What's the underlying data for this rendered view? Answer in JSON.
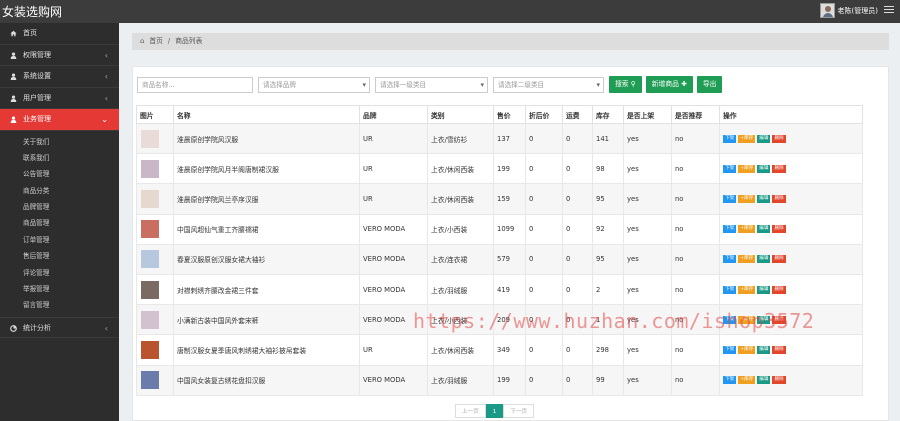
{
  "app": {
    "title": "女装选购网",
    "user": "老陈(管理员)"
  },
  "sidebar": {
    "items": [
      {
        "label": "首页",
        "icon": "home-icon"
      },
      {
        "label": "权限管理",
        "icon": "user-icon"
      },
      {
        "label": "系统设置",
        "icon": "user-icon"
      },
      {
        "label": "用户管理",
        "icon": "user-icon"
      },
      {
        "label": "业务管理",
        "icon": "user-icon"
      }
    ],
    "subitems": [
      "关于我们",
      "联系我们",
      "公告管理",
      "商品分类",
      "品牌管理",
      "商品管理",
      "订单管理",
      "售后管理",
      "评论管理",
      "举报管理",
      "留言管理"
    ],
    "bottom": {
      "label": "统计分析",
      "icon": "chart-icon"
    }
  },
  "breadcrumb": {
    "home": "首页",
    "sep": "/",
    "current": "商品列表"
  },
  "filters": {
    "name_placeholder": "商品名称...",
    "brand": "请选择品牌",
    "cat1": "请选择一级类目",
    "cat2": "请选择二级类目",
    "search": "搜索",
    "add": "新增商品",
    "export": "导出"
  },
  "table": {
    "headers": [
      "图片",
      "名称",
      "品牌",
      "类别",
      "售价",
      "折后价",
      "运费",
      "库存",
      "是否上架",
      "是否推荐",
      "操作"
    ],
    "rows": [
      {
        "name": "淮晨原创学院风汉服",
        "brand": "UR",
        "cat": "上衣/雪纺衫",
        "price": "137",
        "disc": "0",
        "ship": "0",
        "stock": "141",
        "on": "yes",
        "rec": "no"
      },
      {
        "name": "淮晨原创学院风月半阁唐制裙汉服",
        "brand": "UR",
        "cat": "上衣/休闲西装",
        "price": "199",
        "disc": "0",
        "ship": "0",
        "stock": "98",
        "on": "yes",
        "rec": "no"
      },
      {
        "name": "淮晨原创学院风兰亭序汉服",
        "brand": "UR",
        "cat": "上衣/休闲西装",
        "price": "159",
        "disc": "0",
        "ship": "0",
        "stock": "95",
        "on": "yes",
        "rec": "no"
      },
      {
        "name": "中国风超仙气重工齐腰襦裙",
        "brand": "VERO MODA",
        "cat": "上衣/小西装",
        "price": "1099",
        "disc": "0",
        "ship": "0",
        "stock": "92",
        "on": "yes",
        "rec": "no"
      },
      {
        "name": "春夏汉服原创汉服女裙大袖衫",
        "brand": "VERO MODA",
        "cat": "上衣/连衣裙",
        "price": "579",
        "disc": "0",
        "ship": "0",
        "stock": "95",
        "on": "yes",
        "rec": "no"
      },
      {
        "name": "对襟刺绣齐腰改金裙三件套",
        "brand": "VERO MODA",
        "cat": "上衣/羽绒服",
        "price": "419",
        "disc": "0",
        "ship": "0",
        "stock": "2",
        "on": "yes",
        "rec": "no"
      },
      {
        "name": "小满新古装中国风外套宋裤",
        "brand": "VERO MODA",
        "cat": "上衣/小西装",
        "price": "209",
        "disc": "0",
        "ship": "0",
        "stock": "1",
        "on": "yes",
        "rec": "no"
      },
      {
        "name": "唐制汉服女夏季唐风刺绣裙大袖衫披帛套装",
        "brand": "UR",
        "cat": "上衣/休闲西装",
        "price": "349",
        "disc": "0",
        "ship": "0",
        "stock": "298",
        "on": "yes",
        "rec": "no"
      },
      {
        "name": "中国风女装复古绣花盘扣汉服",
        "brand": "VERO MODA",
        "cat": "上衣/羽绒服",
        "price": "199",
        "disc": "0",
        "ship": "0",
        "stock": "99",
        "on": "yes",
        "rec": "no"
      }
    ],
    "actions": [
      "下架",
      "+库存",
      "编辑",
      "删除"
    ]
  },
  "pager": {
    "prev": "上一页",
    "current": "1",
    "next": "下一页"
  },
  "watermark": "https://www.huzhan.com/ishop3572",
  "colors": {
    "accent": "#e53935",
    "green": "#1f9d55",
    "teal": "#1a9a86",
    "sidebar": "#2d2d2d",
    "topbar": "#3c3c3c"
  },
  "thumb_colors": [
    "#e9dcd8",
    "#c9b7c8",
    "#e7d8cf",
    "#c86f62",
    "#b7c7de",
    "#7a6a63",
    "#d2c2d0",
    "#b9542e",
    "#6b7cab"
  ]
}
